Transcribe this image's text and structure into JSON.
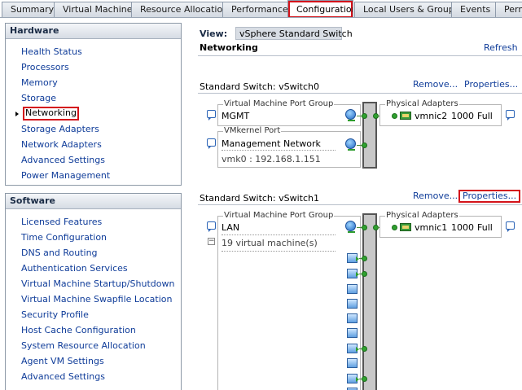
{
  "tabs": [
    "Summary",
    "Virtual Machines",
    "Resource Allocation",
    "Performance",
    "Configuration",
    "Local Users & Groups",
    "Events",
    "Perm"
  ],
  "hardware": {
    "title": "Hardware",
    "items": [
      "Health Status",
      "Processors",
      "Memory",
      "Storage",
      "Networking",
      "Storage Adapters",
      "Network Adapters",
      "Advanced Settings",
      "Power Management"
    ]
  },
  "software": {
    "title": "Software",
    "items": [
      "Licensed Features",
      "Time Configuration",
      "DNS and Routing",
      "Authentication Services",
      "Virtual Machine Startup/Shutdown",
      "Virtual Machine Swapfile Location",
      "Security Profile",
      "Host Cache Configuration",
      "System Resource Allocation",
      "Agent VM Settings",
      "Advanced Settings"
    ]
  },
  "view": {
    "label": "View:",
    "value": "vSphere Standard Switch"
  },
  "networking": {
    "title": "Networking",
    "refresh": "Refresh"
  },
  "switches": [
    {
      "title": "Standard Switch: vSwitch0",
      "remove": "Remove...",
      "properties": "Properties...",
      "port_groups": [
        {
          "legend": "Virtual Machine Port Group",
          "name": "MGMT"
        },
        {
          "legend": "VMkernel Port",
          "name": "Management Network",
          "detail": "vmk0 : 192.168.1.151"
        }
      ],
      "adapters": {
        "legend": "Physical Adapters",
        "name": "vmnic2",
        "speed": "1000",
        "duplex": "Full"
      }
    },
    {
      "title": "Standard Switch: vSwitch1",
      "remove": "Remove...",
      "properties": "Properties...",
      "port_groups": [
        {
          "legend": "Virtual Machine Port Group",
          "name": "LAN",
          "vm_count": "19 virtual machine(s)"
        }
      ],
      "adapters": {
        "legend": "Physical Adapters",
        "name": "vmnic1",
        "speed": "1000",
        "duplex": "Full"
      }
    }
  ],
  "highlight_color": "#d4141b",
  "link_color": "#0f3c99"
}
